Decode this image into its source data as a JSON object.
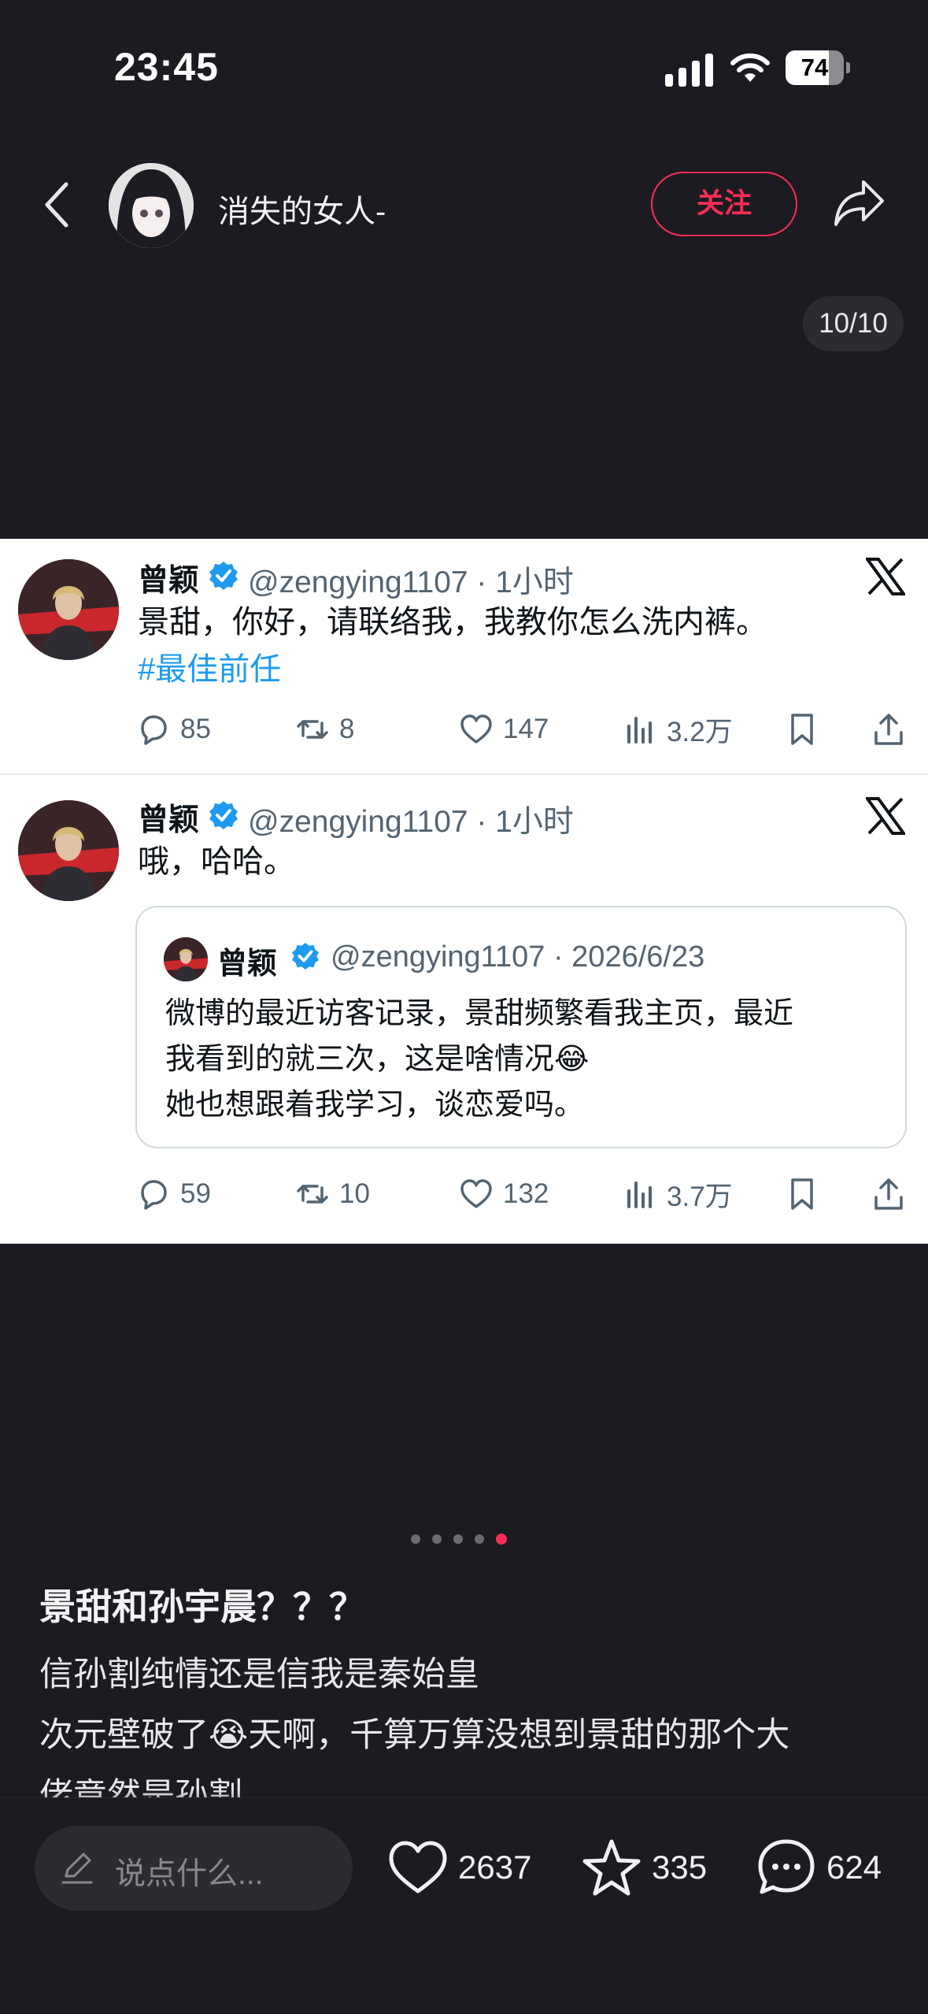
{
  "status_bar": {
    "time": "23:45",
    "battery": "74",
    "battery_level": 0.74
  },
  "header": {
    "username": "消失的女人-",
    "follow_label": "关注",
    "page_counter": "10/10"
  },
  "tweets": [
    {
      "name": "曾颖",
      "handle": "@zengying1107 · 1小时",
      "text": "景甜，你好，请联络我，我教你怎么洗内裤。",
      "hashtag": "#最佳前任",
      "replies": "85",
      "retweets": "8",
      "likes": "147",
      "views": "3.2万"
    },
    {
      "name": "曾颖",
      "handle": "@zengying1107 · 1小时",
      "text": "哦，哈哈。",
      "quote": {
        "name": "曾颖",
        "handle": "@zengying1107 · 2026/6/23",
        "line1": "微博的最近访客记录，景甜频繁看我主页，最近",
        "line2": "我看到的就三次，这是啥情况😂",
        "line3": "她也想跟着我学习，谈恋爱吗。"
      },
      "replies": "59",
      "retweets": "10",
      "likes": "132",
      "views": "3.7万"
    }
  ],
  "pager": {
    "count": 5,
    "active_index": 4
  },
  "post": {
    "title": "景甜和孙宇晨？？？",
    "line1": "信孙割纯情还是信我是秦始皇",
    "line2": "次元壁破了😭天啊，千算万算没想到景甜的那个大",
    "line3": "佬竟然是孙割"
  },
  "bottom_bar": {
    "comment_placeholder": "说点什么...",
    "likes": "2637",
    "favorites": "335",
    "comments": "624"
  },
  "colors": {
    "accent": "#ff2d55",
    "twitter_blue": "#1d9bf0",
    "background": "#1b1b21"
  }
}
